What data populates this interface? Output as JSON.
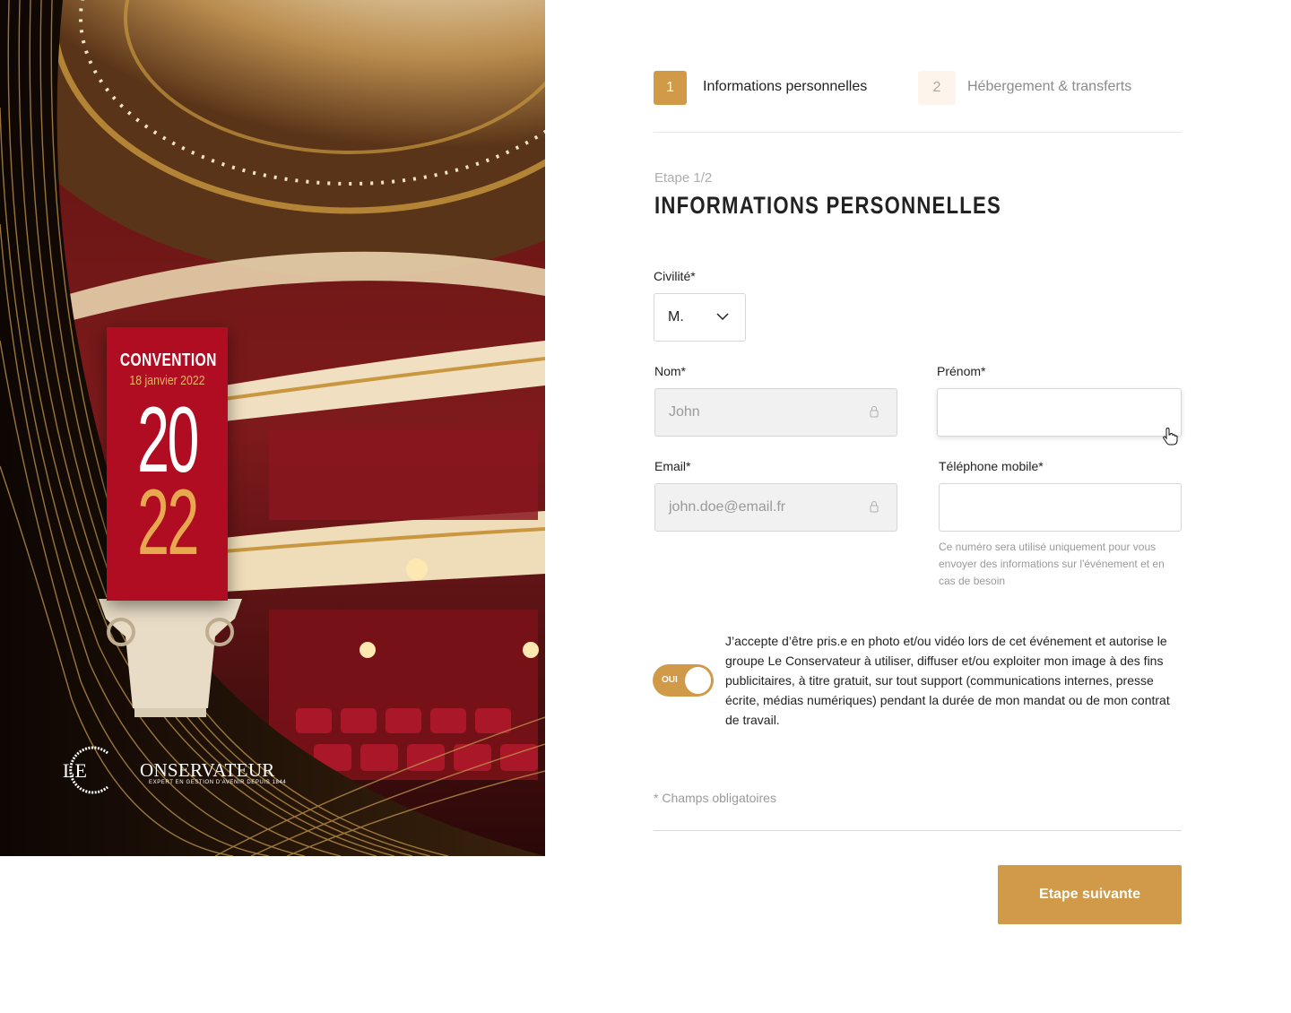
{
  "hero": {
    "banner": {
      "title": "CONVENTION",
      "date": "18 janvier 2022",
      "year_top": "20",
      "year_bottom": "22"
    },
    "logo": {
      "prefix": "LE",
      "name": "ONSERVATEUR",
      "tagline": "EXPERT EN GESTION D'AVENIR DEPUIS 1844"
    }
  },
  "stepper": {
    "steps": [
      {
        "number": "1",
        "label": "Informations personnelles",
        "state": "active"
      },
      {
        "number": "2",
        "label": "Hébergement & transferts",
        "state": "upcoming"
      }
    ]
  },
  "form": {
    "step_caption": "Etape 1/2",
    "title": "INFORMATIONS PERSONNELLES",
    "civilite": {
      "label": "Civilité*",
      "value": "M.",
      "icon": "chevron-down-icon"
    },
    "nom": {
      "label": "Nom*",
      "value": "John",
      "locked": true,
      "icon": "lock-icon"
    },
    "prenom": {
      "label": "Prénom*",
      "value": ""
    },
    "email": {
      "label": "Email*",
      "value": "john.doe@email.fr",
      "locked": true,
      "icon": "lock-icon"
    },
    "telephone": {
      "label": "Téléphone mobile*",
      "value": "",
      "hint": "Ce numéro sera utilisé uniquement pour vous envoyer des informations sur l'événement et en cas de besoin"
    },
    "consent": {
      "toggle_label": "OUI",
      "checked": true,
      "text": "J’accepte d’être pris.e en photo et/ou vidéo lors de cet événement et autorise le groupe Le Conservateur à utiliser, diffuser et/ou exploiter mon image à des fins publicitaires, à titre gratuit, sur tout support (communications internes, presse écrite, médias numériques) pendant la durée de mon mandat ou de mon contrat de travail."
    },
    "required_note": "* Champs obligatoires",
    "next_button": "Etape suivante"
  },
  "colors": {
    "accent": "#d09a48",
    "banner_red": "#b00d22",
    "step_inactive_bg": "#fdf5ec"
  }
}
